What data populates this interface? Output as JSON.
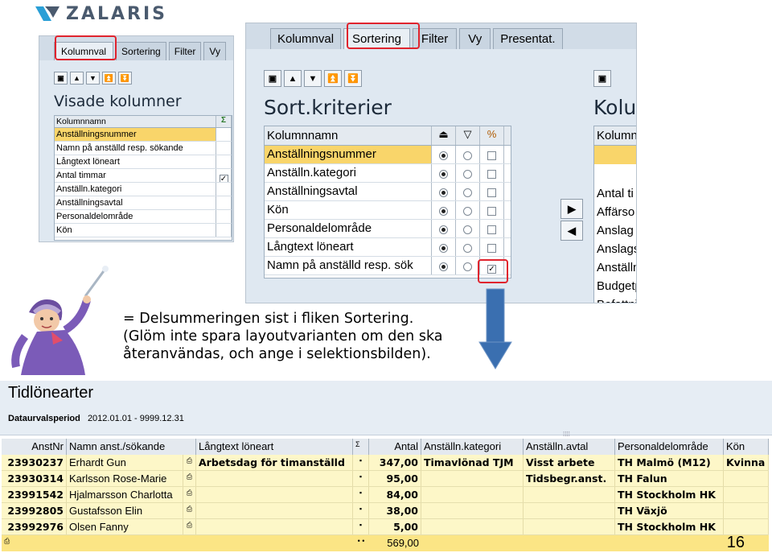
{
  "logo": {
    "text": "ZALARIS"
  },
  "left_panel": {
    "tabs": [
      "Kolumnval",
      "Sortering",
      "Filter",
      "Vy"
    ],
    "title": "Visade kolumner",
    "column_header": "Kolumnnamn",
    "rows": [
      "Anställningsnummer",
      "Namn på anställd resp. sökande",
      "Långtext löneart",
      "Antal timmar",
      "Anställn.kategori",
      "Anställningsavtal",
      "Personaldelområde",
      "Kön"
    ]
  },
  "sort_panel": {
    "tabs": [
      "Kolumnval",
      "Sortering",
      "Filter",
      "Vy",
      "Presentat."
    ],
    "title": "Sort.kriterier",
    "column_header": "Kolumnnamn",
    "rows": [
      "Anställningsnummer",
      "Anställn.kategori",
      "Anställningsavtal",
      "Kön",
      "Personaldelområde",
      "Långtext löneart",
      "Namn på anställd resp. sök"
    ],
    "right_title": "Kolu",
    "right_header": "Kolumn",
    "right_rows": [
      "Antal ti",
      "Affärso",
      "Anslag",
      "Anslags",
      "Anställn",
      "Budgetp",
      "Befattni"
    ]
  },
  "caption": {
    "line1": "= Delsummeringen sist i fliken Sortering.",
    "line2": "(Glöm inte spara layoutvarianten om den ska",
    "line3": "återanvändas, och ange i selektionsbilden)."
  },
  "report": {
    "title": "Tidlönearter",
    "period_label": "Dataurvalsperiod",
    "period_value": "2012.01.01 - 9999.12.31",
    "headers": [
      "AnstNr",
      "Namn anst./sökande",
      "Långtext löneart",
      "Σ",
      "Antal",
      "Anställn.kategori",
      "Anställn.avtal",
      "Personaldelområde",
      "Kön"
    ],
    "rows": [
      {
        "anstnr": "23930237",
        "namn": "Erhardt Gun",
        "lonart": "Arbetsdag för timanställd",
        "antal": "347,00",
        "kategori": "Timavlönad TJM",
        "avtal": "Visst arbete",
        "omrade": "TH Malmö (M12)",
        "kon": "Kvinna"
      },
      {
        "anstnr": "23930314",
        "namn": "Karlsson Rose-Marie",
        "lonart": "",
        "antal": "95,00",
        "kategori": "",
        "avtal": "Tidsbegr.anst.",
        "omrade": "TH Falun",
        "kon": ""
      },
      {
        "anstnr": "23991542",
        "namn": "Hjalmarsson Charlotta",
        "lonart": "",
        "antal": "84,00",
        "kategori": "",
        "avtal": "",
        "omrade": "TH Stockholm HK",
        "kon": ""
      },
      {
        "anstnr": "23992805",
        "namn": "Gustafsson Elin",
        "lonart": "",
        "antal": "38,00",
        "kategori": "",
        "avtal": "",
        "omrade": "TH Växjö",
        "kon": ""
      },
      {
        "anstnr": "23992976",
        "namn": "Olsen Fanny",
        "lonart": "",
        "antal": "5,00",
        "kategori": "",
        "avtal": "",
        "omrade": "TH Stockholm HK",
        "kon": ""
      }
    ],
    "total_marker": "• •",
    "total": "569,00"
  },
  "page_number": "16",
  "colors": {
    "highlight": "#f9d56a",
    "red_box": "#e0242e",
    "arrow": "#3a6fb0",
    "row_bg": "#fdf7c8"
  }
}
